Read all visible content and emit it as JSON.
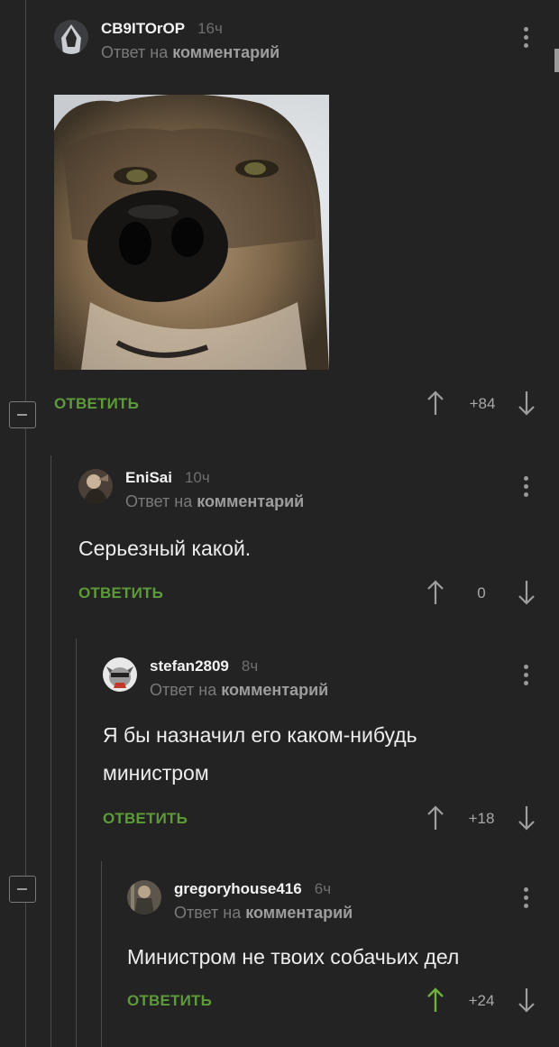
{
  "reply_label": "ОТВЕТИТЬ",
  "reply_to_prefix": "Ответ на",
  "reply_to_link": "комментарий",
  "comments": [
    {
      "username": "СВ9IТОrОР",
      "time": "16ч",
      "rating": "+84"
    },
    {
      "username": "EniSai",
      "time": "10ч",
      "text": "Серьезный какой.",
      "rating": "0"
    },
    {
      "username": "stefan2809",
      "time": "8ч",
      "text_lines": [
        "Я бы назначил его каком-нибудь",
        "министром"
      ],
      "rating": "+18"
    },
    {
      "username": "gregoryhouse416",
      "time": "6ч",
      "text": "Министром не твоих собачьих дел",
      "rating": "+24",
      "upvoted": true
    }
  ],
  "colors": {
    "background": "#232323",
    "accent_green": "#5d9b3a",
    "upvote_active": "#6fb33f"
  }
}
